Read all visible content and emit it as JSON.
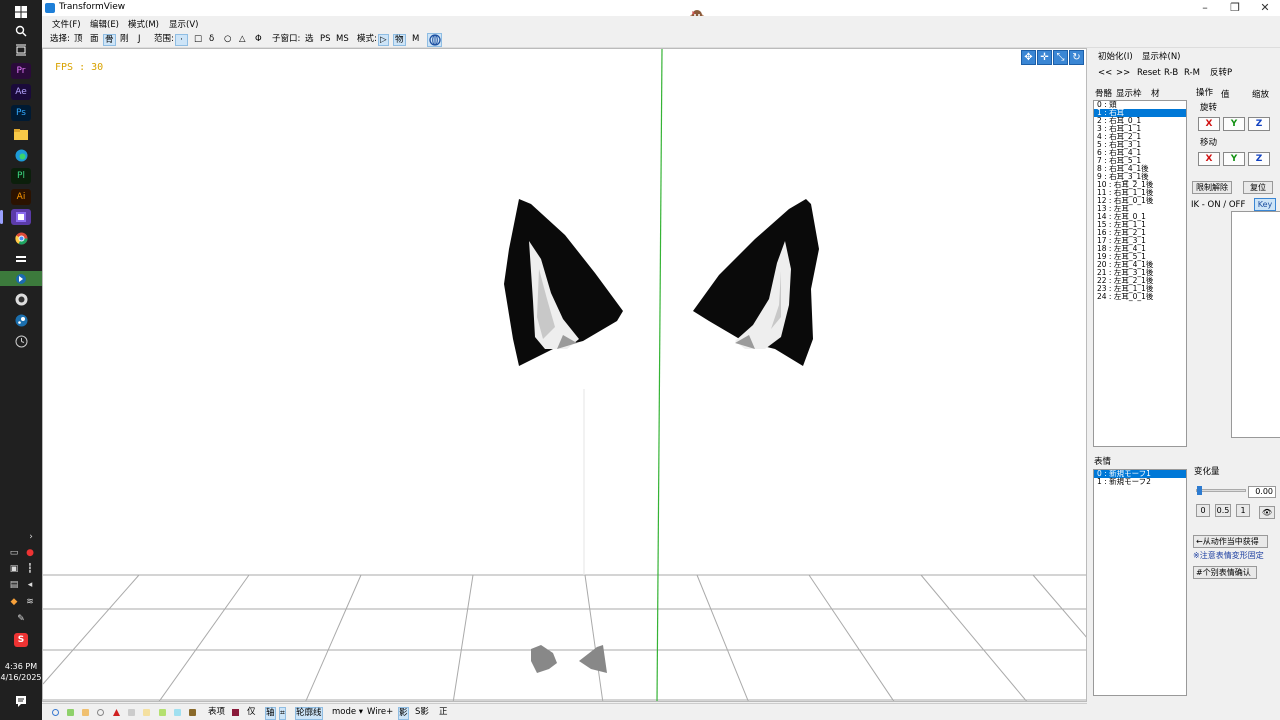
{
  "window": {
    "title": "TransformView"
  },
  "taskbar": {
    "time": "4:36 PM",
    "date": "4/16/2025"
  },
  "menus": [
    "文件(F)",
    "编辑(E)",
    "模式(M)",
    "显示(V)"
  ],
  "toolbar": {
    "select_label": "选择:",
    "select_items": [
      "顶",
      "面",
      "骨",
      "刚",
      "J"
    ],
    "range_label": "范围:",
    "range_items": [
      "·",
      "□",
      "δ",
      "○",
      "△",
      "Φ"
    ],
    "subwin_label": "子窗口:",
    "subwin_items": [
      "选",
      "PS",
      "MS"
    ],
    "mode_label": "模式:",
    "mode_items": [
      "▷",
      "物",
      "M"
    ]
  },
  "viewport": {
    "fps": "FPS : 30"
  },
  "status": {
    "table_label": "表项",
    "chk": "仅",
    "axis": "轴",
    "outline": "轮廓线",
    "mode": "mode ▾",
    "wire": "Wire+",
    "shadow": "影",
    "sshadow": "S影",
    "front": "正"
  },
  "panel": {
    "init": "初始化(I)",
    "display_frame": "显示枠(N)",
    "prev": "<<",
    "next": ">>",
    "reset": "Reset",
    "rb": "R-B",
    "rm": "R-M",
    "flip": "反转P",
    "tabs": [
      "骨骼",
      "显示枠",
      "材"
    ],
    "op_tabs": [
      "操作",
      "值",
      "缩放"
    ],
    "rotate": "旋转",
    "move": "移动",
    "axes": [
      "X",
      "Y",
      "Z"
    ],
    "limit_release": "限制解除",
    "restore": "复位",
    "ik": "IK - ON / OFF",
    "key": "Key",
    "bones": [
      "0 : 頭",
      "1 : 右耳",
      "2 : 右耳_0_1",
      "3 : 右耳_1_1",
      "4 : 右耳_2_1",
      "5 : 右耳_3_1",
      "6 : 右耳_4_1",
      "7 : 右耳_5_1",
      "8 : 右耳_4_1後",
      "9 : 右耳_3_1後",
      "10 : 右耳_2_1後",
      "11 : 右耳_1_1後",
      "12 : 右耳_0_1後",
      "13 : 左耳",
      "14 : 左耳_0_1",
      "15 : 左耳_1_1",
      "16 : 左耳_2_1",
      "17 : 左耳_3_1",
      "18 : 左耳_4_1",
      "19 : 左耳_5_1",
      "20 : 左耳_4_1後",
      "21 : 左耳_3_1後",
      "22 : 左耳_2_1後",
      "23 : 左耳_1_1後",
      "24 : 左耳_0_1後"
    ],
    "selected_bone": 1,
    "expression_label": "表情",
    "expressions": [
      "0 : 新規モーフ1",
      "1 : 新規モーフ2"
    ],
    "selected_expression": 0,
    "change_label": "变化量",
    "change_value": "0.00",
    "slider_fraction": 0,
    "quick": [
      "0",
      "0.5",
      "1"
    ],
    "from_motion": "←从动作当中获得",
    "note": "※注意表情変形固定",
    "confirm": "#个别表情确认"
  }
}
